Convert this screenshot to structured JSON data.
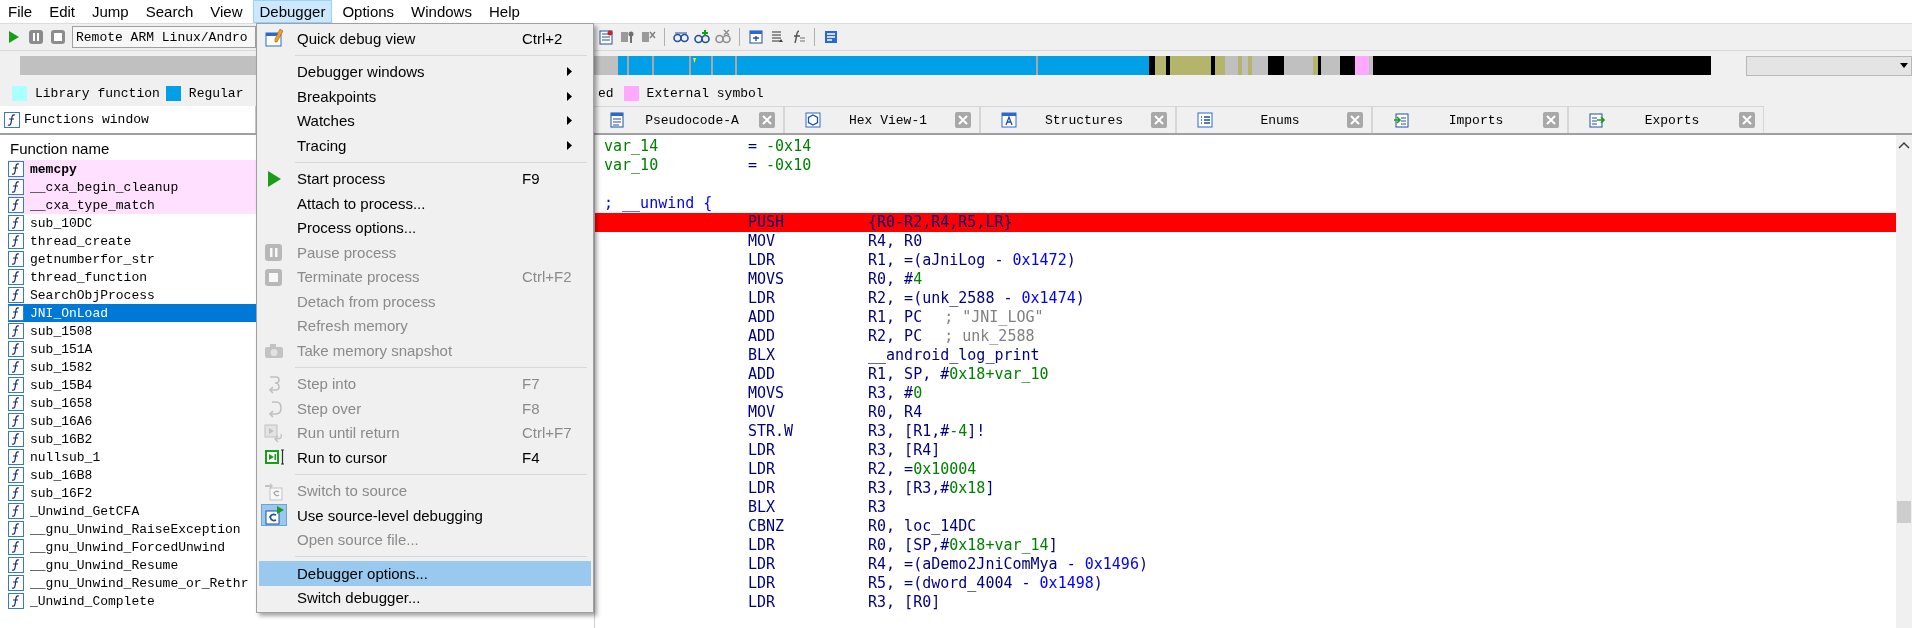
{
  "menu_bar": [
    {
      "label": "File",
      "selected": false
    },
    {
      "label": "Edit",
      "selected": false
    },
    {
      "label": "Jump",
      "selected": false
    },
    {
      "label": "Search",
      "selected": false
    },
    {
      "label": "View",
      "selected": false
    },
    {
      "label": "Debugger",
      "selected": true
    },
    {
      "label": "Options",
      "selected": false
    },
    {
      "label": "Windows",
      "selected": false
    },
    {
      "label": "Help",
      "selected": false
    }
  ],
  "toolbar": {
    "debugger_field": "Remote ARM Linux/Andro"
  },
  "legend": [
    {
      "label": "Library function",
      "color": "#aaffff"
    },
    {
      "label": "Regular",
      "color": "#00a0e6"
    },
    {
      "label": "ed"
    },
    {
      "label": "External symbol",
      "color": "#ffa8ff"
    }
  ],
  "functions_window": {
    "title": "Functions window",
    "column": "Function name",
    "rows": [
      {
        "name": "memcpy",
        "bold": true,
        "color": "#ffe0ff",
        "selected": false
      },
      {
        "name": "__cxa_begin_cleanup",
        "bold": false,
        "color": "#ffe0ff",
        "selected": false
      },
      {
        "name": "__cxa_type_match",
        "bold": false,
        "color": "#ffe0ff",
        "selected": false
      },
      {
        "name": "sub_10DC",
        "bold": false,
        "selected": false
      },
      {
        "name": "thread_create",
        "bold": false,
        "selected": false
      },
      {
        "name": "getnumberfor_str",
        "bold": false,
        "selected": false
      },
      {
        "name": "thread_function",
        "bold": false,
        "selected": false
      },
      {
        "name": "SearchObjProcess",
        "bold": false,
        "selected": false
      },
      {
        "name": "JNI_OnLoad",
        "bold": false,
        "selected": true
      },
      {
        "name": "sub_1508",
        "bold": false,
        "selected": false
      },
      {
        "name": "sub_151A",
        "bold": false,
        "selected": false
      },
      {
        "name": "sub_1582",
        "bold": false,
        "selected": false
      },
      {
        "name": "sub_15B4",
        "bold": false,
        "selected": false
      },
      {
        "name": "sub_1658",
        "bold": false,
        "selected": false
      },
      {
        "name": "sub_16A6",
        "bold": false,
        "selected": false
      },
      {
        "name": "sub_16B2",
        "bold": false,
        "selected": false
      },
      {
        "name": "nullsub_1",
        "bold": false,
        "selected": false
      },
      {
        "name": "sub_16B8",
        "bold": false,
        "selected": false
      },
      {
        "name": "sub_16F2",
        "bold": false,
        "selected": false
      },
      {
        "name": "_Unwind_GetCFA",
        "bold": false,
        "selected": false
      },
      {
        "name": "__gnu_Unwind_RaiseException",
        "bold": false,
        "selected": false
      },
      {
        "name": "__gnu_Unwind_ForcedUnwind",
        "bold": false,
        "selected": false
      },
      {
        "name": "__gnu_Unwind_Resume",
        "bold": false,
        "selected": false
      },
      {
        "name": "__gnu_Unwind_Resume_or_Rethr",
        "bold": false,
        "selected": false
      },
      {
        "name": "_Unwind_Complete",
        "bold": false,
        "selected": false
      }
    ]
  },
  "tabs": [
    {
      "label": "Pseudocode-A",
      "selected": false
    },
    {
      "label": "Hex View-1",
      "selected": false
    },
    {
      "label": "Structures",
      "selected": false
    },
    {
      "label": "Enums",
      "selected": false
    },
    {
      "label": "Imports",
      "selected": false
    },
    {
      "label": "Exports",
      "selected": false
    }
  ],
  "code": [
    {
      "kind": "stackvar",
      "name": "var_14",
      "operands": [
        {
          "text": "= ",
          "kind": "plain"
        },
        {
          "text": "-0x14",
          "kind": "number"
        }
      ]
    },
    {
      "kind": "stackvar",
      "name": "var_10",
      "operands": [
        {
          "text": "= ",
          "kind": "plain"
        },
        {
          "text": "-0x10",
          "kind": "number"
        }
      ]
    },
    {
      "kind": "blank"
    },
    {
      "kind": "comment",
      "text": "; __unwind {"
    },
    {
      "kind": "insn",
      "highlighted": true,
      "mnemonic": "PUSH",
      "operands": [
        {
          "text": "{R0-R2,R4,R5,LR}",
          "kind": "plain"
        }
      ]
    },
    {
      "kind": "insn",
      "highlighted": false,
      "mnemonic": "MOV",
      "operands": [
        {
          "text": "R4, R0",
          "kind": "plain"
        }
      ]
    },
    {
      "kind": "insn",
      "highlighted": false,
      "mnemonic": "LDR",
      "operands": [
        {
          "text": "R1, =(aJniLog - ",
          "kind": "plain"
        },
        {
          "text": "0x1472",
          "kind": "offset"
        },
        {
          "text": ")",
          "kind": "plain"
        }
      ]
    },
    {
      "kind": "insn",
      "highlighted": false,
      "mnemonic": "MOVS",
      "operands": [
        {
          "text": "R0, #",
          "kind": "plain"
        },
        {
          "text": "4",
          "kind": "number"
        }
      ]
    },
    {
      "kind": "insn",
      "highlighted": false,
      "mnemonic": "LDR",
      "operands": [
        {
          "text": "R2, =(unk_2588 - ",
          "kind": "plain"
        },
        {
          "text": "0x1474",
          "kind": "offset"
        },
        {
          "text": ")",
          "kind": "plain"
        }
      ]
    },
    {
      "kind": "insn",
      "highlighted": false,
      "mnemonic": "ADD",
      "operands": [
        {
          "text": "R1, PC",
          "kind": "plain"
        }
      ],
      "comment": "; \"JNI_LOG\""
    },
    {
      "kind": "insn",
      "highlighted": false,
      "mnemonic": "ADD",
      "operands": [
        {
          "text": "R2, PC",
          "kind": "plain"
        }
      ],
      "comment": "; unk_2588"
    },
    {
      "kind": "insn",
      "highlighted": false,
      "mnemonic": "BLX",
      "operands": [
        {
          "text": "__android_log_print",
          "kind": "plain"
        }
      ]
    },
    {
      "kind": "insn",
      "highlighted": false,
      "mnemonic": "ADD",
      "operands": [
        {
          "text": "R1, SP, #",
          "kind": "plain"
        },
        {
          "text": "0x18+var_10",
          "kind": "number"
        }
      ]
    },
    {
      "kind": "insn",
      "highlighted": false,
      "mnemonic": "MOVS",
      "operands": [
        {
          "text": "R3, #",
          "kind": "plain"
        },
        {
          "text": "0",
          "kind": "number"
        }
      ]
    },
    {
      "kind": "insn",
      "highlighted": false,
      "mnemonic": "MOV",
      "operands": [
        {
          "text": "R0, R4",
          "kind": "plain"
        }
      ]
    },
    {
      "kind": "insn",
      "highlighted": false,
      "mnemonic": "STR.W",
      "operands": [
        {
          "text": "R3, [R1,#",
          "kind": "plain"
        },
        {
          "text": "-4",
          "kind": "number"
        },
        {
          "text": "]!",
          "kind": "plain"
        }
      ]
    },
    {
      "kind": "insn",
      "highlighted": false,
      "mnemonic": "LDR",
      "operands": [
        {
          "text": "R3, [R4]",
          "kind": "plain"
        }
      ]
    },
    {
      "kind": "insn",
      "highlighted": false,
      "mnemonic": "LDR",
      "operands": [
        {
          "text": "R2, =",
          "kind": "plain"
        },
        {
          "text": "0x10004",
          "kind": "number"
        }
      ]
    },
    {
      "kind": "insn",
      "highlighted": false,
      "mnemonic": "LDR",
      "operands": [
        {
          "text": "R3, [R3,#",
          "kind": "plain"
        },
        {
          "text": "0x18",
          "kind": "number"
        },
        {
          "text": "]",
          "kind": "plain"
        }
      ]
    },
    {
      "kind": "insn",
      "highlighted": false,
      "mnemonic": "BLX",
      "operands": [
        {
          "text": "R3",
          "kind": "plain"
        }
      ]
    },
    {
      "kind": "insn",
      "highlighted": false,
      "mnemonic": "CBNZ",
      "operands": [
        {
          "text": "R0, loc_14DC",
          "kind": "plain"
        }
      ]
    },
    {
      "kind": "insn",
      "highlighted": false,
      "mnemonic": "LDR",
      "operands": [
        {
          "text": "R0, [SP,#",
          "kind": "plain"
        },
        {
          "text": "0x18+var_14",
          "kind": "number"
        },
        {
          "text": "]",
          "kind": "plain"
        }
      ]
    },
    {
      "kind": "insn",
      "highlighted": false,
      "mnemonic": "LDR",
      "operands": [
        {
          "text": "R4, =(aDemo2JniComMya - ",
          "kind": "plain"
        },
        {
          "text": "0x1496",
          "kind": "offset"
        },
        {
          "text": ")",
          "kind": "plain"
        }
      ]
    },
    {
      "kind": "insn",
      "highlighted": false,
      "mnemonic": "LDR",
      "operands": [
        {
          "text": "R5, =(dword_4004 - ",
          "kind": "plain"
        },
        {
          "text": "0x1498",
          "kind": "offset"
        },
        {
          "text": ")",
          "kind": "plain"
        }
      ]
    },
    {
      "kind": "insn",
      "highlighted": false,
      "mnemonic": "LDR",
      "operands": [
        {
          "text": "R3, [R0]",
          "kind": "plain"
        }
      ]
    }
  ],
  "debugger_menu": {
    "items": [
      {
        "kind": "command",
        "label": "Quick debug view",
        "shortcut": "Ctrl+2",
        "disabled": false,
        "selected": false,
        "checked": false
      },
      {
        "kind": "separator"
      },
      {
        "kind": "submenu",
        "label": "Debugger windows",
        "disabled": false,
        "selected": false,
        "checked": false
      },
      {
        "kind": "submenu",
        "label": "Breakpoints",
        "disabled": false,
        "selected": false,
        "checked": false
      },
      {
        "kind": "submenu",
        "label": "Watches",
        "disabled": false,
        "selected": false,
        "checked": false
      },
      {
        "kind": "submenu",
        "label": "Tracing",
        "disabled": false,
        "selected": false,
        "checked": false
      },
      {
        "kind": "separator"
      },
      {
        "kind": "command",
        "label": "Start process",
        "shortcut": "F9",
        "disabled": false,
        "selected": false,
        "checked": false
      },
      {
        "kind": "command",
        "label": "Attach to process...",
        "disabled": false,
        "selected": false,
        "checked": false
      },
      {
        "kind": "command",
        "label": "Process options...",
        "disabled": false,
        "selected": false,
        "checked": false
      },
      {
        "kind": "command",
        "label": "Pause process",
        "disabled": true,
        "selected": false,
        "checked": false
      },
      {
        "kind": "command",
        "label": "Terminate process",
        "shortcut": "Ctrl+F2",
        "disabled": true,
        "selected": false,
        "checked": false
      },
      {
        "kind": "command",
        "label": "Detach from process",
        "disabled": true,
        "selected": false,
        "checked": false
      },
      {
        "kind": "command",
        "label": "Refresh memory",
        "disabled": true,
        "selected": false,
        "checked": false
      },
      {
        "kind": "command",
        "label": "Take memory snapshot",
        "disabled": true,
        "selected": false,
        "checked": false
      },
      {
        "kind": "separator"
      },
      {
        "kind": "command",
        "label": "Step into",
        "shortcut": "F7",
        "disabled": true,
        "selected": false,
        "checked": false
      },
      {
        "kind": "command",
        "label": "Step over",
        "shortcut": "F8",
        "disabled": true,
        "selected": false,
        "checked": false
      },
      {
        "kind": "command",
        "label": "Run until return",
        "shortcut": "Ctrl+F7",
        "disabled": true,
        "selected": false,
        "checked": false
      },
      {
        "kind": "command",
        "label": "Run to cursor",
        "shortcut": "F4",
        "disabled": false,
        "selected": false,
        "checked": false
      },
      {
        "kind": "separator"
      },
      {
        "kind": "command",
        "label": "Switch to source",
        "disabled": true,
        "selected": false,
        "checked": false
      },
      {
        "kind": "command",
        "label": "Use source-level debugging",
        "disabled": false,
        "selected": false,
        "checked": true
      },
      {
        "kind": "command",
        "label": "Open source file...",
        "disabled": true,
        "selected": false,
        "checked": false
      },
      {
        "kind": "separator"
      },
      {
        "kind": "command",
        "label": "Debugger options...",
        "disabled": false,
        "selected": true,
        "checked": false
      },
      {
        "kind": "command",
        "label": "Switch debugger...",
        "disabled": false,
        "selected": false,
        "checked": false
      }
    ]
  }
}
